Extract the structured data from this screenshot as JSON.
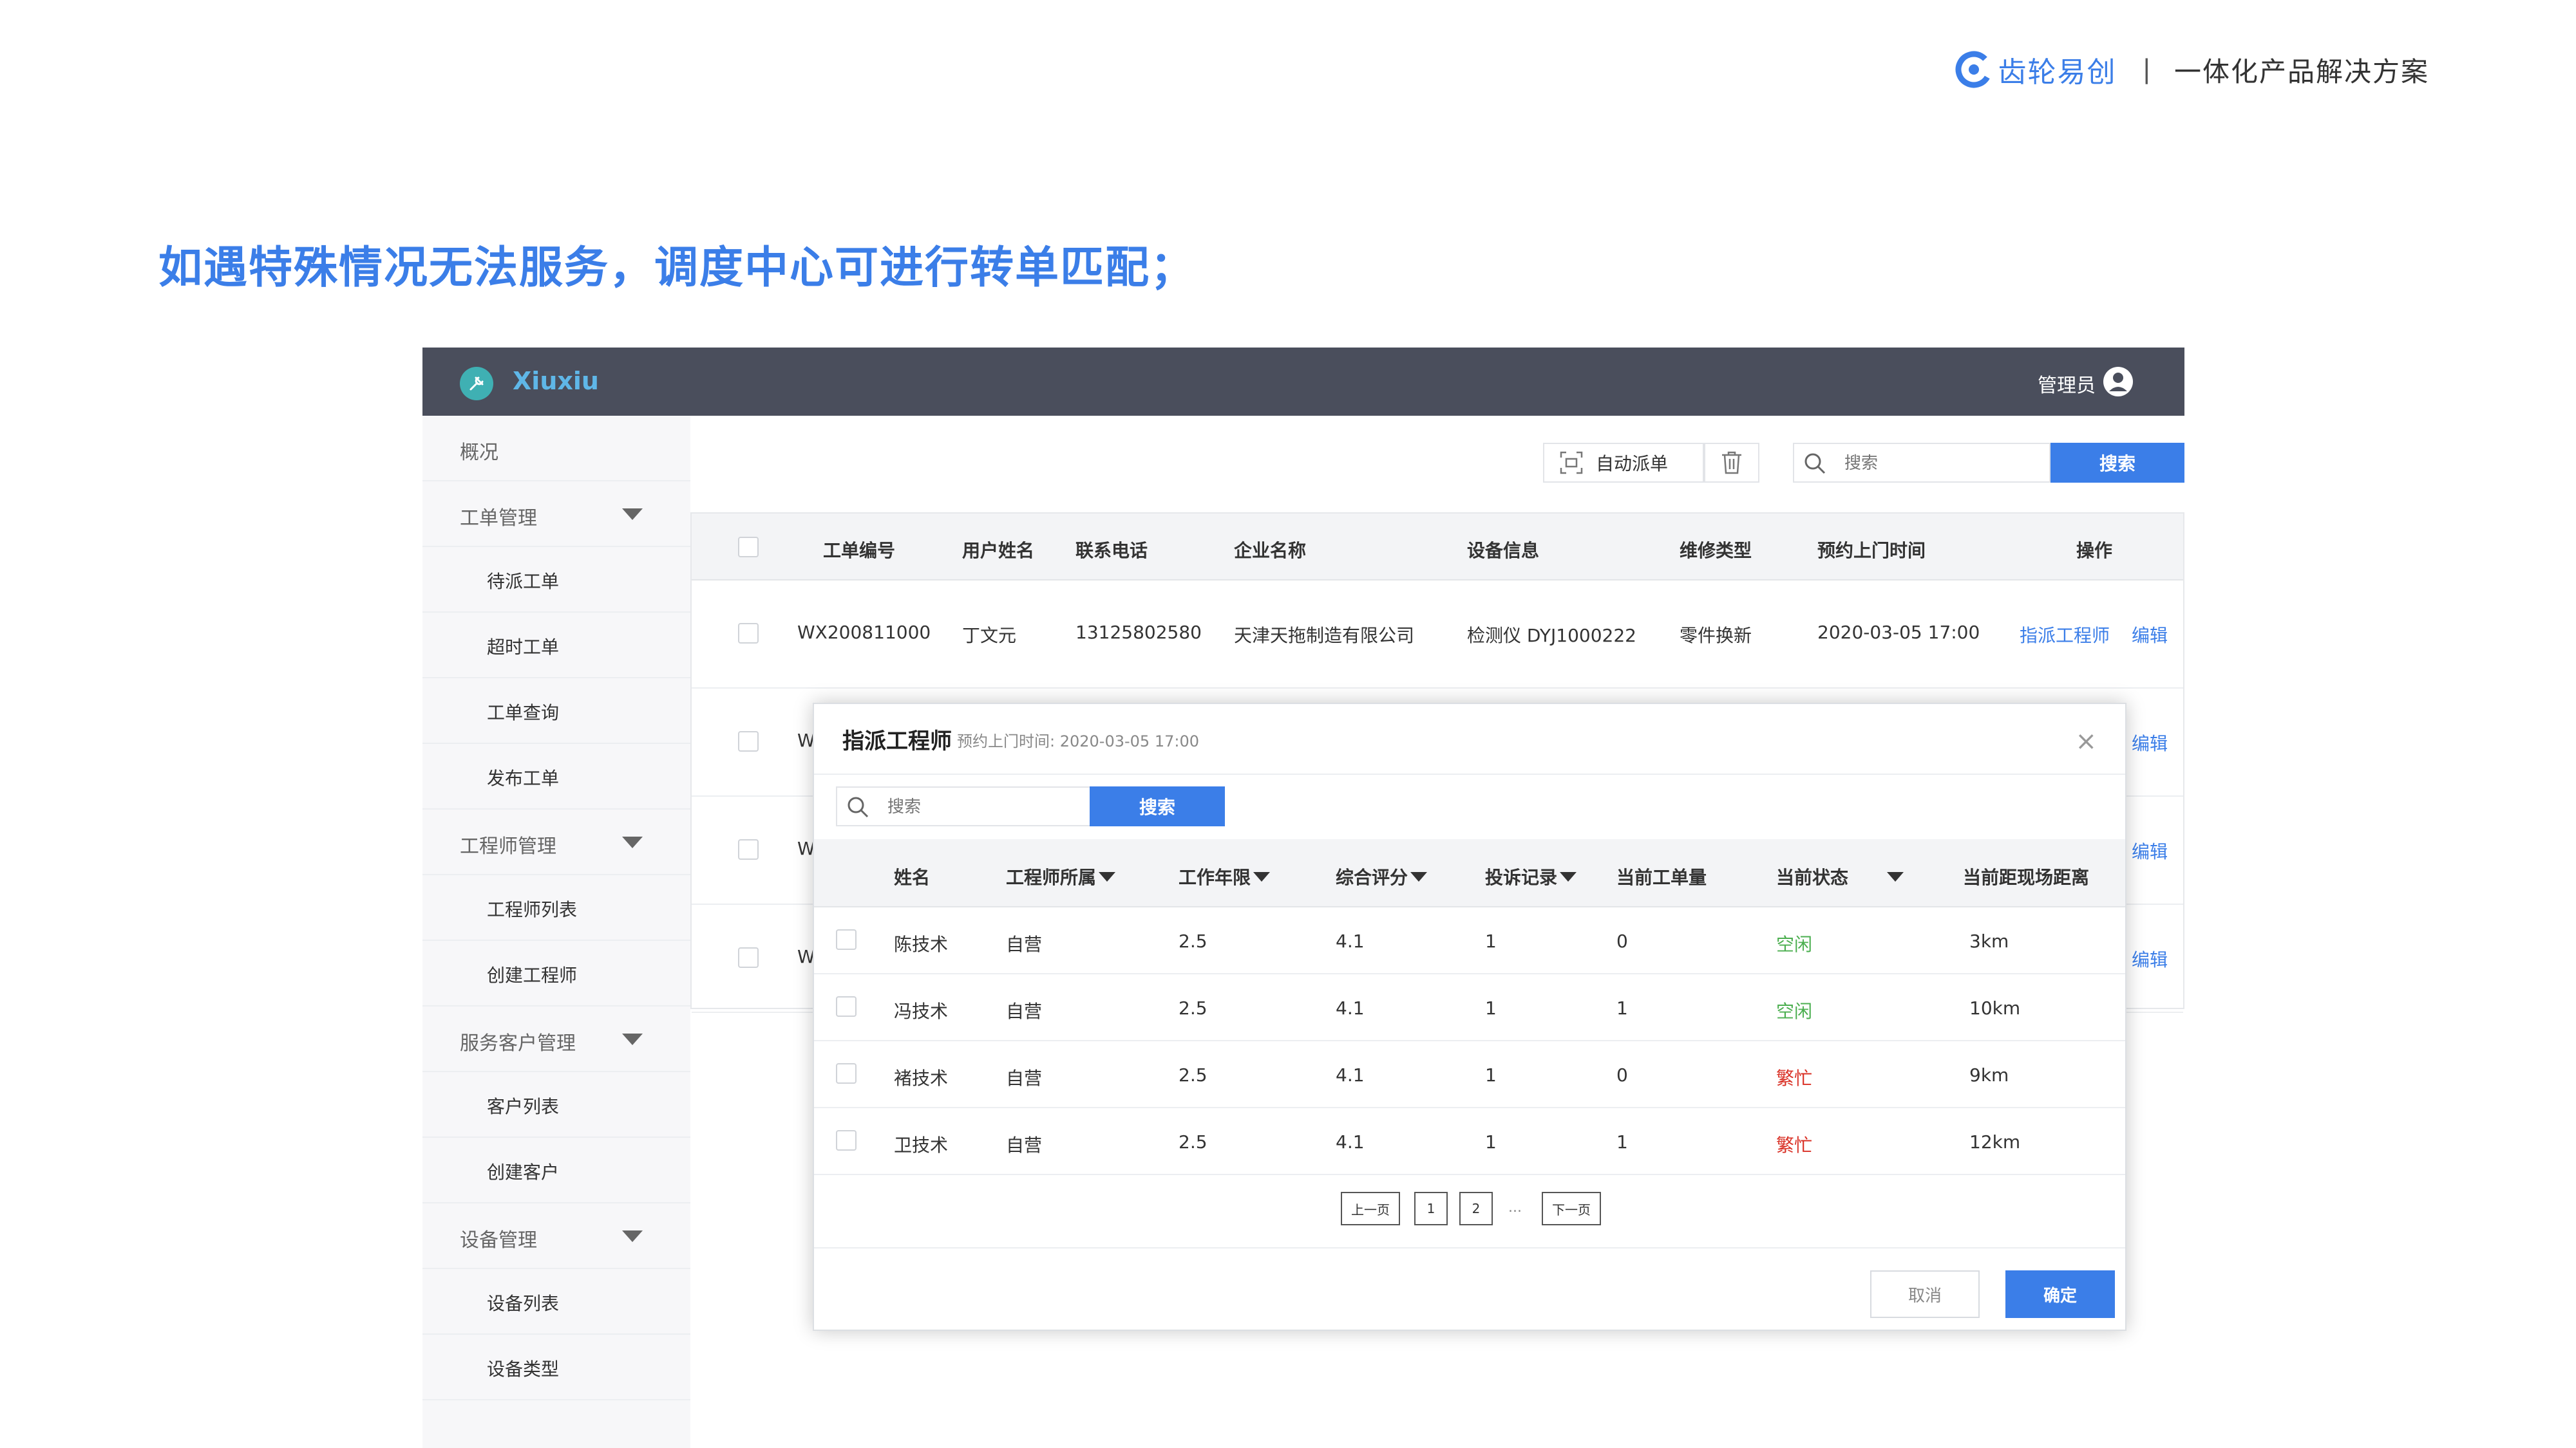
{
  "brand": {
    "name": "齿轮易创",
    "separator": "|",
    "slogan": "一体化产品解决方案",
    "accent": "#3b7ee8"
  },
  "headline": "如遇特殊情况无法服务，调度中心可进行转单匹配；",
  "app": {
    "name": "Xiuxiu",
    "logo_icon": "tools-icon",
    "admin_label": "管理员",
    "admin_icon": "user-avatar-icon"
  },
  "sidebar": {
    "items": [
      {
        "label": "概况",
        "type": "group",
        "collapsible": false
      },
      {
        "label": "工单管理",
        "type": "group",
        "collapsible": true
      },
      {
        "label": "待派工单",
        "type": "sub"
      },
      {
        "label": "超时工单",
        "type": "sub"
      },
      {
        "label": "工单查询",
        "type": "sub"
      },
      {
        "label": "发布工单",
        "type": "sub"
      },
      {
        "label": "工程师管理",
        "type": "group",
        "collapsible": true
      },
      {
        "label": "工程师列表",
        "type": "sub"
      },
      {
        "label": "创建工程师",
        "type": "sub"
      },
      {
        "label": "服务客户管理",
        "type": "group",
        "collapsible": true
      },
      {
        "label": "客户列表",
        "type": "sub"
      },
      {
        "label": "创建客户",
        "type": "sub"
      },
      {
        "label": "设备管理",
        "type": "group",
        "collapsible": true
      },
      {
        "label": "设备列表",
        "type": "sub"
      },
      {
        "label": "设备类型",
        "type": "sub"
      }
    ]
  },
  "toolbar": {
    "auto_dispatch_label": "自动派单",
    "auto_dispatch_icon": "scan-icon",
    "delete_icon": "trash-icon",
    "search_placeholder": "搜索",
    "search_button": "搜索"
  },
  "orders_table": {
    "headers": [
      "工单编号",
      "用户姓名",
      "联系电话",
      "企业名称",
      "设备信息",
      "维修类型",
      "预约上门时间",
      "操作"
    ],
    "rows": [
      {
        "id": "WX200811000",
        "user": "丁文元",
        "phone": "13125802580",
        "company": "天津天拖制造有限公司",
        "device": "检测仪 DYJ1000222",
        "repair_type": "零件换新",
        "time": "2020-03-05 17:00",
        "action_assign": "指派工程师",
        "action_edit": "编辑"
      },
      {
        "id_fragment": "W",
        "action_edit": "编辑"
      },
      {
        "id_fragment": "W",
        "action_edit": "编辑"
      },
      {
        "id_fragment": "W",
        "action_edit": "编辑"
      }
    ]
  },
  "modal": {
    "title": "指派工程师",
    "subtitle": "预约上门时间: 2020-03-05 17:00",
    "close_icon": "close-icon",
    "search_placeholder": "搜索",
    "search_button": "搜索",
    "headers": [
      "姓名",
      "工程师所属",
      "工作年限",
      "综合评分",
      "投诉记录",
      "当前工单量",
      "当前状态",
      "当前距现场距离"
    ],
    "rows": [
      {
        "name": "陈技术",
        "affiliation": "自营",
        "years": "2.5",
        "score": "4.1",
        "complaints": "1",
        "workload": "0",
        "status": "空闲",
        "distance": "3km"
      },
      {
        "name": "冯技术",
        "affiliation": "自营",
        "years": "2.5",
        "score": "4.1",
        "complaints": "1",
        "workload": "1",
        "status": "空闲",
        "distance": "10km"
      },
      {
        "name": "褚技术",
        "affiliation": "自营",
        "years": "2.5",
        "score": "4.1",
        "complaints": "1",
        "workload": "0",
        "status": "繁忙",
        "distance": "9km"
      },
      {
        "name": "卫技术",
        "affiliation": "自营",
        "years": "2.5",
        "score": "4.1",
        "complaints": "1",
        "workload": "1",
        "status": "繁忙",
        "distance": "12km"
      }
    ],
    "status_colors": {
      "空闲": "#4caf50",
      "繁忙": "#d93025"
    },
    "pagination": {
      "prev": "上一页",
      "pages": [
        "1",
        "2"
      ],
      "ellipsis": "...",
      "next": "下一页"
    },
    "cancel_button": "取消",
    "confirm_button": "确定"
  }
}
